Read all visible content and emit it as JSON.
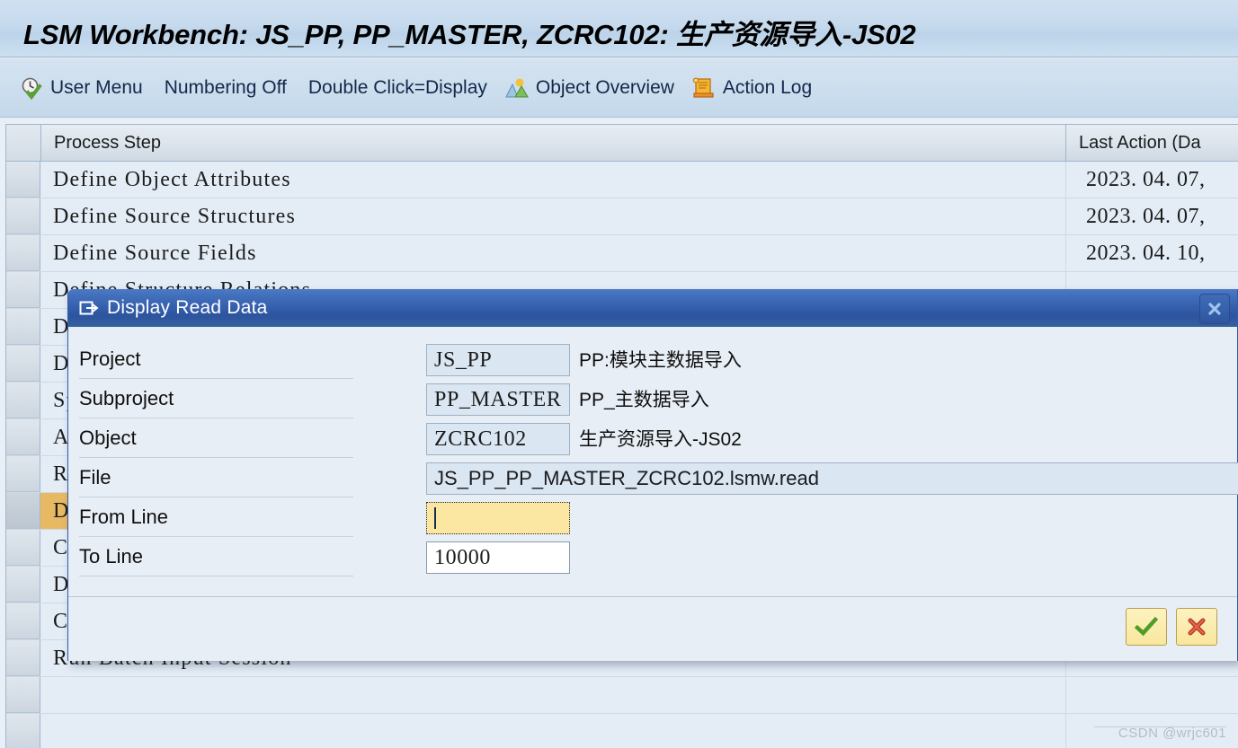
{
  "window": {
    "title": "LSM Workbench: JS_PP, PP_MASTER, ZCRC102: 生产资源导入-JS02"
  },
  "toolbar": {
    "items": [
      {
        "label": "User Menu",
        "icon": "clock-check-icon",
        "has_icon": true
      },
      {
        "label": "Numbering Off",
        "icon": "",
        "has_icon": false
      },
      {
        "label": "Double Click=Display",
        "icon": "",
        "has_icon": false
      },
      {
        "label": "Object Overview",
        "icon": "landscape-icon",
        "has_icon": true
      },
      {
        "label": "Action Log",
        "icon": "scroll-icon",
        "has_icon": true
      }
    ]
  },
  "grid": {
    "columns": [
      "Process Step",
      "Last Action (Da"
    ],
    "rows": [
      {
        "step": "Define Object Attributes",
        "date": "2023. 04. 07,",
        "selected": false
      },
      {
        "step": "Define Source Structures",
        "date": "2023. 04. 07,",
        "selected": false
      },
      {
        "step": "Define Source Fields",
        "date": "2023. 04. 10,",
        "selected": false
      },
      {
        "step": "Define Structure Relations",
        "date": "",
        "selected": false
      },
      {
        "step": "Define Field Mapping and Conversion Rules",
        "date": "",
        "selected": false
      },
      {
        "step": "Define Fixed Values, Translations, User-Defined Routines",
        "date": "",
        "selected": false
      },
      {
        "step": "Specify Files",
        "date": "",
        "selected": false
      },
      {
        "step": "Assign Files",
        "date": "",
        "selected": false
      },
      {
        "step": "Read Data",
        "date": "",
        "selected": false
      },
      {
        "step": "Display Read Data",
        "date": "",
        "selected": true
      },
      {
        "step": "Convert Data",
        "date": "",
        "selected": false
      },
      {
        "step": "Display Converted Data",
        "date": "",
        "selected": false
      },
      {
        "step": "Create Batch Input Session",
        "date": "",
        "selected": false
      },
      {
        "step": "Run Batch Input Session",
        "date": "",
        "selected": false
      },
      {
        "step": "",
        "date": "",
        "selected": false
      },
      {
        "step": "",
        "date": "",
        "selected": false
      }
    ]
  },
  "dialog": {
    "title": "Display Read Data",
    "title_icon": "export-window-icon",
    "close_icon": "close-icon",
    "fields": [
      {
        "label": "Project",
        "value": "JS_PP",
        "desc": "PP:模块主数据导入",
        "kind": "readonly"
      },
      {
        "label": "Subproject",
        "value": "PP_MASTER",
        "desc": "PP_主数据导入",
        "kind": "readonly"
      },
      {
        "label": "Object",
        "value": "ZCRC102",
        "desc": "生产资源导入-JS02",
        "kind": "readonly"
      },
      {
        "label": "File",
        "value": "JS_PP_PP_MASTER_ZCRC102.lsmw.read",
        "desc": "",
        "kind": "readonly-wide"
      },
      {
        "label": "From Line",
        "value": "",
        "desc": "",
        "kind": "focus"
      },
      {
        "label": "To Line",
        "value": "10000",
        "desc": "",
        "kind": "editable"
      }
    ],
    "buttons": [
      {
        "name": "confirm",
        "icon": "green-check-icon"
      },
      {
        "name": "cancel",
        "icon": "red-x-icon"
      }
    ]
  },
  "watermark": {
    "text": "CSDN @wrjc601"
  },
  "colors": {
    "title_bar": "#c6daee",
    "dialog_header": "#33599f",
    "focus_field": "#fbe7a2",
    "selected_row": "#e8b963",
    "readonly_field": "#dae6f2"
  }
}
